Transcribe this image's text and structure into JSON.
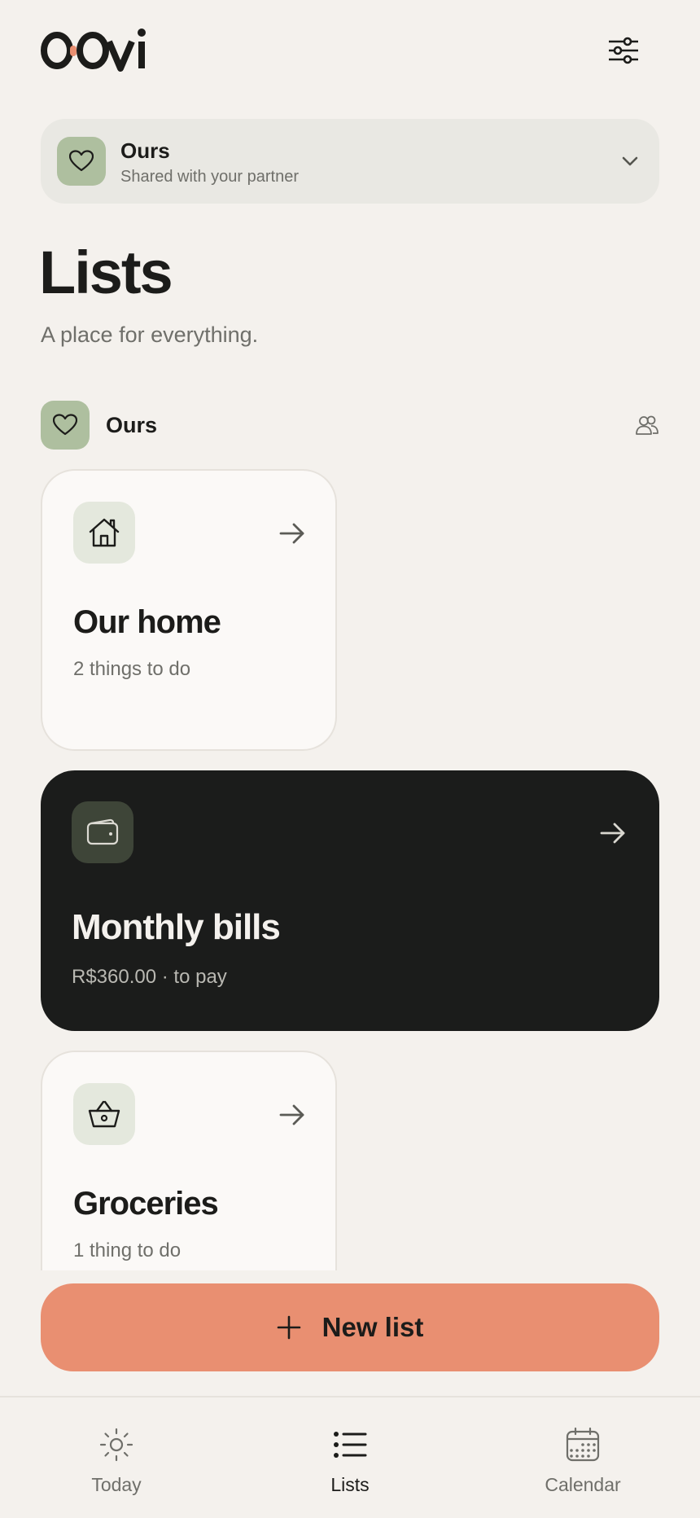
{
  "app": {
    "logo_text": "OOvi"
  },
  "space_selector": {
    "name": "Ours",
    "subtitle": "Shared with your partner"
  },
  "page": {
    "title": "Lists",
    "subtitle": "A place for everything."
  },
  "group": {
    "name": "Ours"
  },
  "lists": [
    {
      "icon": "home-icon",
      "title": "Our home",
      "subtitle": "2 things to do",
      "style": "light"
    },
    {
      "icon": "wallet-icon",
      "title": "Monthly bills",
      "subtitle": "R$360.00 · to pay",
      "style": "dark"
    },
    {
      "icon": "basket-icon",
      "title": "Groceries",
      "subtitle": "1 thing to do",
      "style": "light"
    }
  ],
  "new_list_button": {
    "label": "New list"
  },
  "bottom_nav": [
    {
      "label": "Today",
      "icon": "sun-icon",
      "active": false
    },
    {
      "label": "Lists",
      "icon": "list-icon",
      "active": true
    },
    {
      "label": "Calendar",
      "icon": "calendar-icon",
      "active": false
    }
  ],
  "colors": {
    "background": "#f4f1ed",
    "accent": "#e98f71",
    "sage": "#aebf9f",
    "dark_card": "#1b1c1b",
    "text": "#1c1c1a",
    "muted": "#6f6f6a"
  }
}
